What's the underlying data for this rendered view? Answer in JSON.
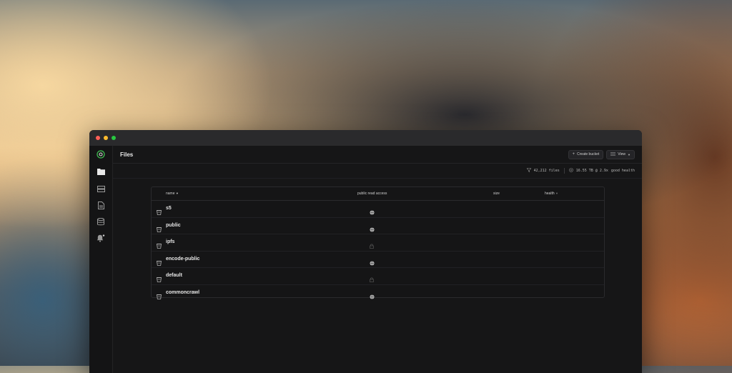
{
  "window": {
    "traffic_lights": {
      "close": "#ff5f57",
      "minimize": "#febc2e",
      "zoom": "#28c840"
    }
  },
  "sidebar": {
    "items": [
      {
        "name": "logo-icon",
        "active": false
      },
      {
        "name": "files-icon",
        "active": true
      },
      {
        "name": "hosts-icon",
        "active": false
      },
      {
        "name": "contracts-icon",
        "active": false
      },
      {
        "name": "database-icon",
        "active": false
      },
      {
        "name": "notifications-icon",
        "active": false
      }
    ],
    "accent": "#3fb950"
  },
  "header": {
    "title": "Files",
    "create_bucket_label": "Create bucket",
    "view_label": "View"
  },
  "stats": {
    "files": "42,212 files",
    "storage": "16.55 TB @ 2.9x",
    "health": "good health"
  },
  "table": {
    "columns": {
      "name": "name",
      "public_read_access": "public read access",
      "size": "size",
      "health": "health"
    },
    "rows": [
      {
        "name": "s5",
        "access": "public"
      },
      {
        "name": "public",
        "access": "public"
      },
      {
        "name": "ipfs",
        "access": "private"
      },
      {
        "name": "encode-public",
        "access": "public"
      },
      {
        "name": "default",
        "access": "private"
      },
      {
        "name": "commoncrawl",
        "access": "public"
      }
    ]
  }
}
